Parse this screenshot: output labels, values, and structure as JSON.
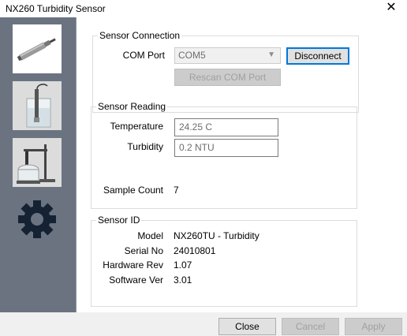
{
  "window": {
    "title": "NX260 Turbidity Sensor",
    "close_glyph": "✕"
  },
  "sidebar": {
    "items": [
      {
        "icon": "probe-icon",
        "selected": true
      },
      {
        "icon": "sensor-in-beaker-icon",
        "selected": false
      },
      {
        "icon": "sensor-on-stand-icon",
        "selected": false
      },
      {
        "icon": "gear-icon",
        "selected": false
      }
    ]
  },
  "connection": {
    "legend": "Sensor Connection",
    "com_port_label": "COM Port",
    "com_port_value": "COM5",
    "disconnect_label": "Disconnect",
    "rescan_label": "Rescan COM Port"
  },
  "reading": {
    "legend": "Sensor Reading",
    "temperature_label": "Temperature",
    "temperature_value": "24.25 C",
    "turbidity_label": "Turbidity",
    "turbidity_value": "0.2 NTU",
    "sample_count_label": "Sample Count",
    "sample_count_value": "7"
  },
  "sensor_id": {
    "legend": "Sensor ID",
    "model_label": "Model",
    "model_value": "NX260TU - Turbidity",
    "serial_label": "Serial No",
    "serial_value": "24010801",
    "hardware_label": "Hardware Rev",
    "hardware_value": "1.07",
    "software_label": "Software Ver",
    "software_value": "3.01"
  },
  "footer": {
    "close_label": "Close",
    "cancel_label": "Cancel",
    "apply_label": "Apply"
  },
  "colors": {
    "sidebar_bg": "#6b7381",
    "focus_border": "#0078d7",
    "group_border": "#dcdcdc"
  }
}
